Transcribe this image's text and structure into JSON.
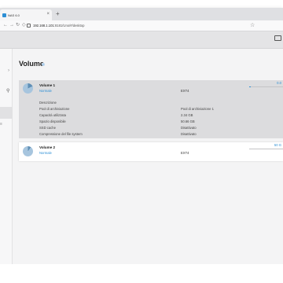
{
  "browser": {
    "tab_title": "NAS 6.0",
    "url_host": "192.168.1.101",
    "url_path": ":8181/Uno/#/desktop"
  },
  "page": {
    "title": "Volume",
    "info_glyph": "i"
  },
  "volumes": [
    {
      "name": "Volume 1",
      "status": "Normale",
      "filesystem": "EXT4",
      "usage_text": "0.0",
      "usage_fraction": 0.05,
      "details": [
        {
          "label": "Descrizione",
          "value": ""
        },
        {
          "label": "Pool di archiviazione",
          "value": "Pool di archiviazione  1"
        },
        {
          "label": "Capacità utilizzata",
          "value": "2.34 GB"
        },
        {
          "label": "Spazio disponibile",
          "value": "50.66 GB"
        },
        {
          "label": "SSD cache",
          "value": "Disattivato"
        },
        {
          "label": "Compressione del file system",
          "value": "Disattivato"
        }
      ]
    },
    {
      "name": "Volume 2",
      "status": "Normale",
      "filesystem": "EXT4",
      "usage_text": "50 G",
      "usage_fraction": 0.0
    }
  ],
  "icons": {
    "close": "×",
    "new_tab": "+",
    "back": "←",
    "forward": "→",
    "reload": "↻",
    "shield": "◇",
    "star": "☆",
    "search": "⚲",
    "arrow": "›",
    "mark": "≡"
  },
  "colors": {
    "accent": "#2d8fd5",
    "card_selected": "#dcdcde"
  }
}
